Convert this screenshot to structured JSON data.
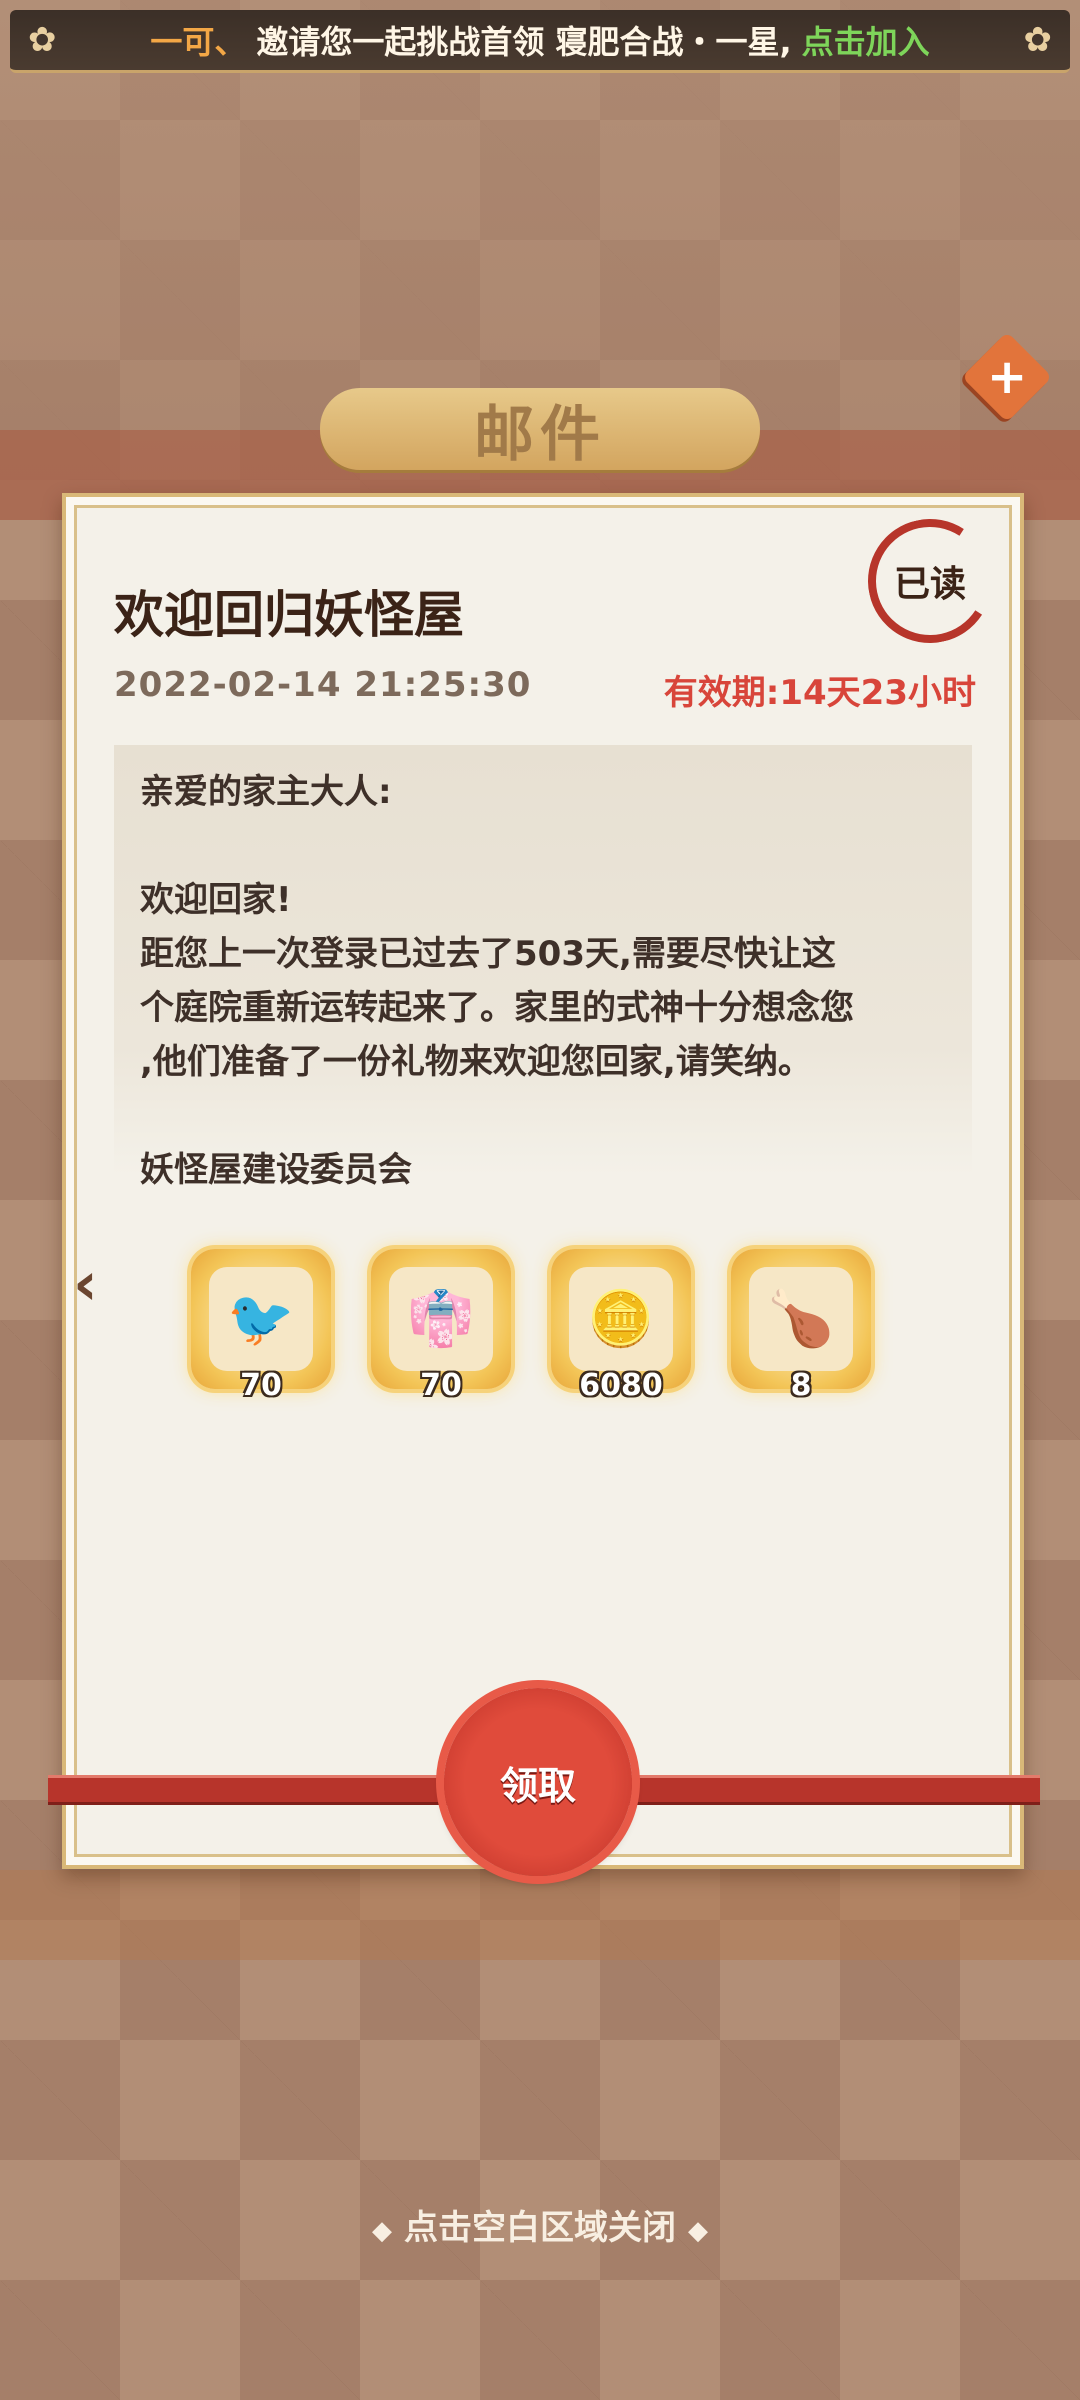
{
  "broadcast": {
    "sender": "一可、",
    "message": "邀请您一起挑战首领 寝肥合战・一星,",
    "join_label": "点击加入"
  },
  "mail_title": "邮件",
  "close_icon": "close-icon",
  "letter": {
    "title": "欢迎回归妖怪屋",
    "read_stamp": "已读",
    "date": "2022-02-14 21:25:30",
    "validity": "有效期:14天23小时",
    "greeting": "亲爱的家主大人:",
    "line1": "欢迎回家!",
    "line2": "距您上一次登录已过去了503天,需要尽快让这",
    "line3": "个庭院重新运转起来了。家里的式神十分想念您",
    "line4": ",他们准备了一份礼物来欢迎您回家,请笑纳。",
    "signature": "妖怪屋建设委员会"
  },
  "rewards": [
    {
      "icon": "paper-figure-icon",
      "count": "70"
    },
    {
      "icon": "costume-scroll-icon",
      "count": "70"
    },
    {
      "icon": "coin-icon",
      "count": "6080"
    },
    {
      "icon": "food-icon",
      "count": "8"
    }
  ],
  "claim_label": "领取",
  "close_hint": "点击空白区域关闭",
  "colors": {
    "accent_red": "#d8453a",
    "claim_red": "#e04b3b",
    "gold": "#d9b878"
  }
}
